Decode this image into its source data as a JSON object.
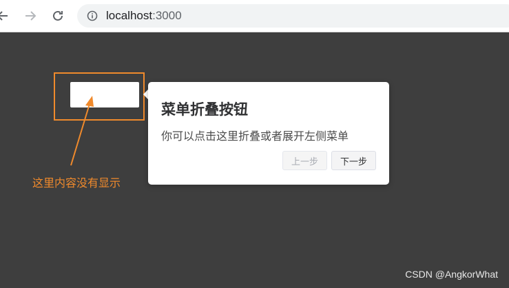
{
  "browser": {
    "url_host": "localhost",
    "url_port": ":3000"
  },
  "popover": {
    "title": "菜单折叠按钮",
    "description": "你可以点击这里折叠或者展开左侧菜单",
    "prev_label": "上一步",
    "next_label": "下一步"
  },
  "annotation": {
    "text": "这里内容没有显示",
    "color": "#f08a2c"
  },
  "watermark": "CSDN @AngkorWhat",
  "colors": {
    "page_background": "#3e3e3e",
    "accent": "#f08a2c"
  }
}
